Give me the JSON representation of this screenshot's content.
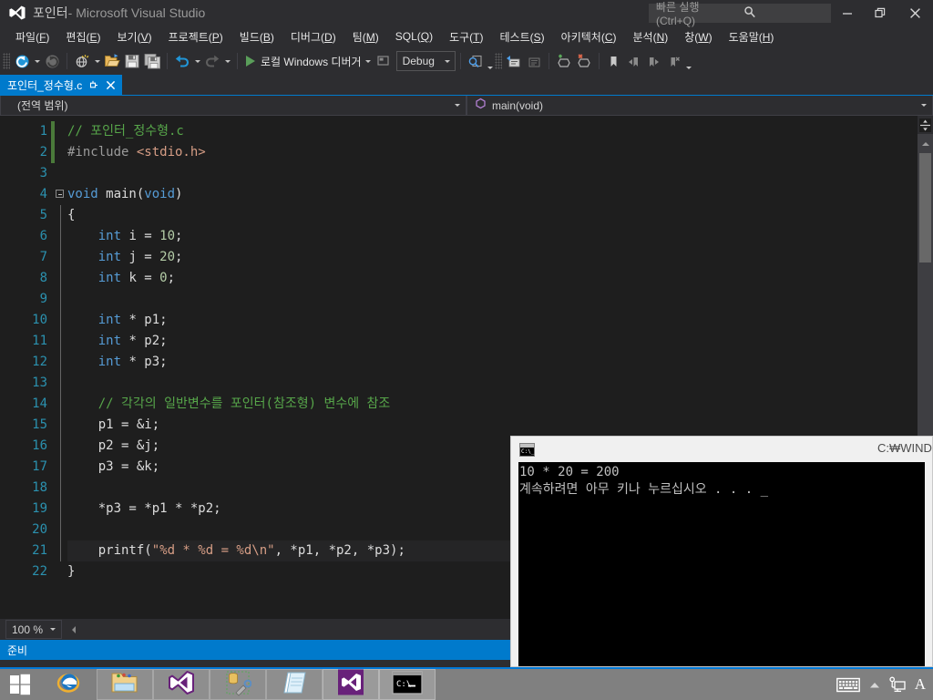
{
  "window": {
    "title_project": "포인터",
    "title_rest": " - Microsoft Visual Studio",
    "logo_icon": "visual-studio-logo-icon",
    "minimize_icon": "minimize-icon",
    "restore_icon": "restore-icon",
    "close_icon": "close-icon"
  },
  "quick_launch": {
    "placeholder": "빠른 실행(Ctrl+Q)",
    "search_icon": "search-icon"
  },
  "menu": {
    "items": [
      {
        "label": "파일(F)",
        "text": "파일",
        "key": "F"
      },
      {
        "label": "편집(E)",
        "text": "편집",
        "key": "E"
      },
      {
        "label": "보기(V)",
        "text": "보기",
        "key": "V"
      },
      {
        "label": "프로젝트(P)",
        "text": "프로젝트",
        "key": "P"
      },
      {
        "label": "빌드(B)",
        "text": "빌드",
        "key": "B"
      },
      {
        "label": "디버그(D)",
        "text": "디버그",
        "key": "D"
      },
      {
        "label": "팀(M)",
        "text": "팀",
        "key": "M"
      },
      {
        "label": "SQL(Q)",
        "text": "SQL",
        "key": "Q"
      },
      {
        "label": "도구(T)",
        "text": "도구",
        "key": "T"
      },
      {
        "label": "테스트(S)",
        "text": "테스트",
        "key": "S"
      },
      {
        "label": "아키텍처(C)",
        "text": "아키텍처",
        "key": "C"
      },
      {
        "label": "분석(N)",
        "text": "분석",
        "key": "N"
      },
      {
        "label": "창(W)",
        "text": "창",
        "key": "W"
      },
      {
        "label": "도움말(H)",
        "text": "도움말",
        "key": "H"
      }
    ]
  },
  "toolbar": {
    "navigate_back_icon": "navigate-back-icon",
    "navigate_forward_icon": "navigate-forward-icon",
    "new_project_icon": "new-project-icon",
    "open_file_icon": "open-file-icon",
    "save_icon": "save-icon",
    "save_all_icon": "save-all-icon",
    "undo_icon": "undo-icon",
    "redo_icon": "redo-icon",
    "run_icon": "play-icon",
    "run_label": "로컬 Windows 디버거",
    "config_icon": "configuration-icon",
    "platform_value": "Debug",
    "find_icon": "find-in-files-icon",
    "comment_icon": "comment-selection-icon",
    "uncomment_icon": "uncomment-selection-icon",
    "add_breakpoint_icon": "add-breakpoint-icon",
    "delete_breakpoint_icon": "delete-breakpoint-icon",
    "bookmark_icon": "bookmark-icon",
    "prev_bookmark_icon": "previous-bookmark-icon",
    "next_bookmark_icon": "next-bookmark-icon",
    "clear_bookmarks_icon": "clear-bookmarks-icon",
    "overflow_icon": "toolbar-overflow-icon"
  },
  "tab": {
    "label": "포인터_정수형.c",
    "pin_icon": "pin-icon",
    "close_icon": "close-icon"
  },
  "navbar": {
    "scope": "(전역 범위)",
    "member": "main(void)",
    "member_icon": "method-icon",
    "caret_icon": "chevron-down-icon"
  },
  "editor": {
    "lines": [
      {
        "n": 1,
        "changed": true,
        "current": false,
        "indent": 0,
        "tokens": [
          {
            "t": "comment",
            "v": "// 포인터_정수형.c"
          }
        ]
      },
      {
        "n": 2,
        "changed": true,
        "current": false,
        "indent": 0,
        "tokens": [
          {
            "t": "pre",
            "v": "#include "
          },
          {
            "t": "inc",
            "v": "<stdio.h>"
          }
        ]
      },
      {
        "n": 3,
        "changed": false,
        "current": false,
        "indent": 0,
        "tokens": []
      },
      {
        "n": 4,
        "changed": false,
        "current": false,
        "indent": 0,
        "collapse": true,
        "tokens": [
          {
            "t": "kw",
            "v": "void"
          },
          {
            "t": "plain",
            "v": " main("
          },
          {
            "t": "kw",
            "v": "void"
          },
          {
            "t": "plain",
            "v": ")"
          }
        ]
      },
      {
        "n": 5,
        "changed": false,
        "current": false,
        "indent": 0,
        "vline": true,
        "tokens": [
          {
            "t": "plain",
            "v": "{"
          }
        ]
      },
      {
        "n": 6,
        "changed": false,
        "current": false,
        "indent": 0,
        "vline": true,
        "tokens": [
          {
            "t": "plain",
            "v": "    "
          },
          {
            "t": "kw",
            "v": "int"
          },
          {
            "t": "plain",
            "v": " i = "
          },
          {
            "t": "num",
            "v": "10"
          },
          {
            "t": "plain",
            "v": ";"
          }
        ]
      },
      {
        "n": 7,
        "changed": false,
        "current": false,
        "indent": 0,
        "vline": true,
        "tokens": [
          {
            "t": "plain",
            "v": "    "
          },
          {
            "t": "kw",
            "v": "int"
          },
          {
            "t": "plain",
            "v": " j = "
          },
          {
            "t": "num",
            "v": "20"
          },
          {
            "t": "plain",
            "v": ";"
          }
        ]
      },
      {
        "n": 8,
        "changed": false,
        "current": false,
        "indent": 0,
        "vline": true,
        "tokens": [
          {
            "t": "plain",
            "v": "    "
          },
          {
            "t": "kw",
            "v": "int"
          },
          {
            "t": "plain",
            "v": " k = "
          },
          {
            "t": "num",
            "v": "0"
          },
          {
            "t": "plain",
            "v": ";"
          }
        ]
      },
      {
        "n": 9,
        "changed": false,
        "current": false,
        "indent": 0,
        "vline": true,
        "tokens": []
      },
      {
        "n": 10,
        "changed": false,
        "current": false,
        "indent": 0,
        "vline": true,
        "tokens": [
          {
            "t": "plain",
            "v": "    "
          },
          {
            "t": "kw",
            "v": "int"
          },
          {
            "t": "plain",
            "v": " * p1;"
          }
        ]
      },
      {
        "n": 11,
        "changed": false,
        "current": false,
        "indent": 0,
        "vline": true,
        "tokens": [
          {
            "t": "plain",
            "v": "    "
          },
          {
            "t": "kw",
            "v": "int"
          },
          {
            "t": "plain",
            "v": " * p2;"
          }
        ]
      },
      {
        "n": 12,
        "changed": false,
        "current": false,
        "indent": 0,
        "vline": true,
        "tokens": [
          {
            "t": "plain",
            "v": "    "
          },
          {
            "t": "kw",
            "v": "int"
          },
          {
            "t": "plain",
            "v": " * p3;"
          }
        ]
      },
      {
        "n": 13,
        "changed": false,
        "current": false,
        "indent": 0,
        "vline": true,
        "tokens": []
      },
      {
        "n": 14,
        "changed": false,
        "current": false,
        "indent": 0,
        "vline": true,
        "tokens": [
          {
            "t": "plain",
            "v": "    "
          },
          {
            "t": "comment",
            "v": "// 각각의 일반변수를 포인터(참조형) 변수에 참조"
          }
        ]
      },
      {
        "n": 15,
        "changed": false,
        "current": false,
        "indent": 0,
        "vline": true,
        "tokens": [
          {
            "t": "plain",
            "v": "    p1 = &i;"
          }
        ]
      },
      {
        "n": 16,
        "changed": false,
        "current": false,
        "indent": 0,
        "vline": true,
        "tokens": [
          {
            "t": "plain",
            "v": "    p2 = &j;"
          }
        ]
      },
      {
        "n": 17,
        "changed": false,
        "current": false,
        "indent": 0,
        "vline": true,
        "tokens": [
          {
            "t": "plain",
            "v": "    p3 = &k;"
          }
        ]
      },
      {
        "n": 18,
        "changed": false,
        "current": false,
        "indent": 0,
        "vline": true,
        "tokens": []
      },
      {
        "n": 19,
        "changed": false,
        "current": false,
        "indent": 0,
        "vline": true,
        "tokens": [
          {
            "t": "plain",
            "v": "    *p3 = *p1 * *p2;"
          }
        ]
      },
      {
        "n": 20,
        "changed": false,
        "current": false,
        "indent": 0,
        "vline": true,
        "tokens": []
      },
      {
        "n": 21,
        "changed": false,
        "current": true,
        "indent": 0,
        "vline": true,
        "tokens": [
          {
            "t": "plain",
            "v": "    printf("
          },
          {
            "t": "str",
            "v": "\"%d * %d = %d\\n\""
          },
          {
            "t": "plain",
            "v": ", *p1, *p2, *p3);"
          }
        ]
      },
      {
        "n": 22,
        "changed": false,
        "current": false,
        "indent": 0,
        "tokens": [
          {
            "t": "plain",
            "v": "}"
          }
        ]
      }
    ],
    "zoom": "100 %",
    "split_icon": "split-view-icon",
    "scroll_up_icon": "scroll-up-icon",
    "scroll_left_icon": "scroll-left-icon"
  },
  "statusbar": {
    "text": "준비"
  },
  "console": {
    "icon": "console-window-icon",
    "path": "C:₩WIND",
    "lines": [
      "10 * 20 = 200",
      "계속하려면 아무 키나 누르십시오 . . ."
    ],
    "cursor": "_"
  },
  "taskbar": {
    "start_icon": "windows-start-icon",
    "items": [
      {
        "icon": "internet-explorer-icon",
        "state": "plain"
      },
      {
        "icon": "file-explorer-icon",
        "state": "boxed"
      },
      {
        "icon": "visual-studio-icon",
        "state": "boxed"
      },
      {
        "icon": "sql-tools-icon",
        "state": "boxed"
      },
      {
        "icon": "notepad-icon",
        "state": "boxed"
      },
      {
        "icon": "visual-studio-icon",
        "state": "active"
      },
      {
        "icon": "command-prompt-icon",
        "state": "active"
      }
    ],
    "tray": [
      {
        "icon": "keyboard-icon"
      },
      {
        "icon": "chevron-up-icon"
      },
      {
        "icon": "network-icon"
      },
      {
        "icon": "ime-alpha-icon",
        "label": "A"
      }
    ]
  },
  "colors": {
    "accent": "#007acc",
    "chrome": "#2d2d30",
    "editor_bg": "#1e1e1e",
    "comment": "#57a64a",
    "keyword": "#569cd6",
    "string": "#d69d85",
    "number": "#b5cea8",
    "linenum": "#2b91af",
    "taskbar": "#808080"
  }
}
